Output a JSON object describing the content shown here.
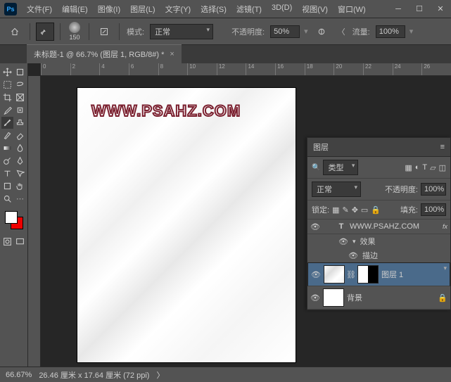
{
  "titlebar": {
    "logo": "Ps"
  },
  "menu": [
    "文件(F)",
    "编辑(E)",
    "图像(I)",
    "图层(L)",
    "文字(Y)",
    "选择(S)",
    "滤镜(T)",
    "3D(D)",
    "视图(V)",
    "窗口(W)"
  ],
  "options": {
    "mode_label": "模式:",
    "mode_value": "正常",
    "opacity_label": "不透明度:",
    "opacity_value": "50%",
    "flow_label": "流量:",
    "flow_value": "100%",
    "brush_size": "150"
  },
  "document": {
    "tab_title": "未标题-1 @ 66.7% (图层 1, RGB/8#) *",
    "canvas_text": "WWW.PSAHZ.COM"
  },
  "ruler_h": [
    "0",
    "2",
    "4",
    "6",
    "8",
    "10",
    "12",
    "14",
    "16",
    "18",
    "20",
    "22",
    "24",
    "26"
  ],
  "layers": {
    "panel_title": "图层",
    "filter_label": "类型",
    "blend_mode": "正常",
    "opacity_label": "不透明度:",
    "opacity_value": "100%",
    "lock_label": "锁定:",
    "fill_label": "填充:",
    "fill_value": "100%",
    "items": [
      {
        "name": "WWW.PSAHZ.COM",
        "type": "text",
        "fx_label": "fx"
      },
      {
        "name": "图层 1",
        "type": "silk"
      },
      {
        "name": "背景",
        "type": "bg"
      }
    ],
    "fx_title": "效果",
    "fx_stroke": "描边"
  },
  "status": {
    "zoom": "66.67%",
    "dims": "26.46 厘米 x 17.64 厘米 (72 ppi)"
  },
  "colors": {
    "fg": "#ffffff",
    "bg": "#e00000"
  }
}
